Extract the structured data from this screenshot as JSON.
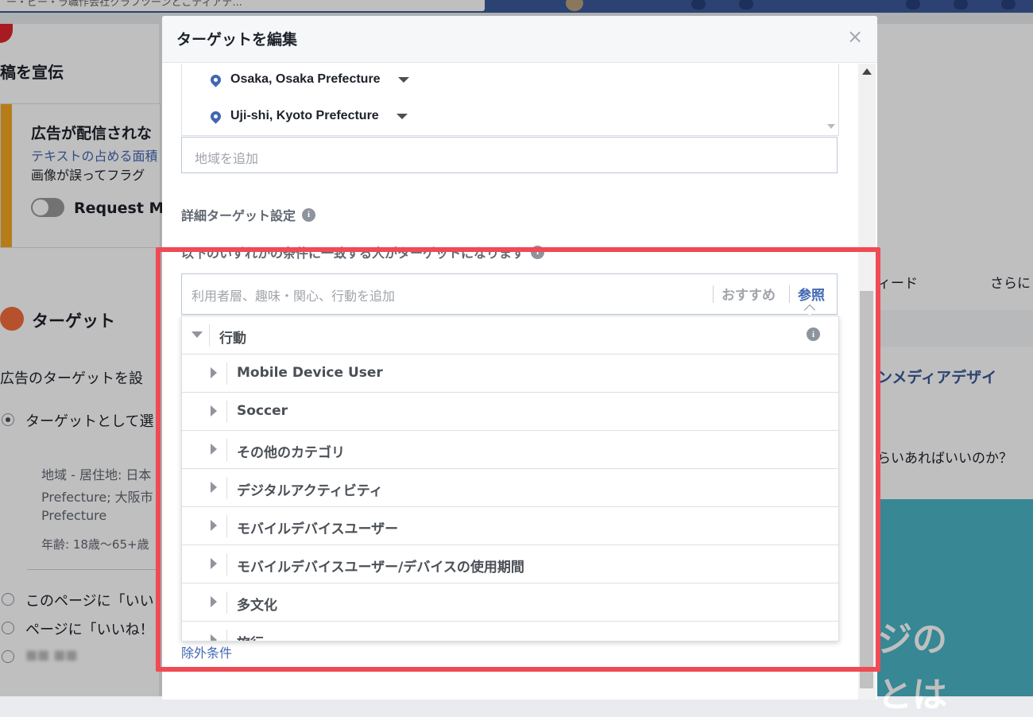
{
  "background": {
    "top_search_text": "ー・ビー・ラ職作会社クラフツーンとこディアデ...",
    "left_panel": {
      "promote_title": "稿を宣伝",
      "warning_title": "広告が配信されな",
      "warning_link": "テキストの占める面積",
      "warning_body": "画像が誤ってフラグ",
      "request_label": "Request Ma",
      "target_title": "ターゲット",
      "target_desc": "広告のターゲットを設",
      "option_selected": "ターゲットとして選",
      "location_summary_1": "地域 - 居住地: 日本",
      "location_summary_2": "Prefecture; 大阪市",
      "location_summary_3": "Prefecture",
      "age_summary": "年齢: 18歳〜65+歳",
      "option_2": "このページに「いい",
      "option_3": "ページに「いいね！",
      "option_4": "■■ ■■"
    },
    "right_panel": {
      "tab_feed": "ィード",
      "tab_more": "さらに",
      "link_text": "ンメディアデザイ",
      "question_text": "らいあればいいのか？",
      "image_text_1": "ジの",
      "image_text_2": "とは"
    }
  },
  "modal": {
    "title": "ターゲットを編集",
    "close_glyph": "×",
    "locations": [
      {
        "name": "Osaka, Osaka Prefecture"
      },
      {
        "name": "Uji-shi, Kyoto Prefecture"
      }
    ],
    "add_location_placeholder": "地域を追加",
    "detailed_targeting_label": "詳細ターゲット設定",
    "match_text": "以下のいずれかの条件に一致する人がターゲットになります",
    "search_placeholder": "利用者層、趣味・関心、行動を追加",
    "suggestions_label": "おすすめ",
    "browse_label": "参照",
    "category": {
      "label": "行動",
      "items": [
        "Mobile Device User",
        "Soccer",
        "その他のカテゴリ",
        "デジタルアクティビティ",
        "モバイルデバイスユーザー",
        "モバイルデバイスユーザー/デバイスの使用期間",
        "多文化",
        "旅行"
      ]
    },
    "exclude_label": "除外条件"
  },
  "colors": {
    "highlight": "#f04a55",
    "link": "#4267b2",
    "warning_bar": "#f5a623"
  }
}
